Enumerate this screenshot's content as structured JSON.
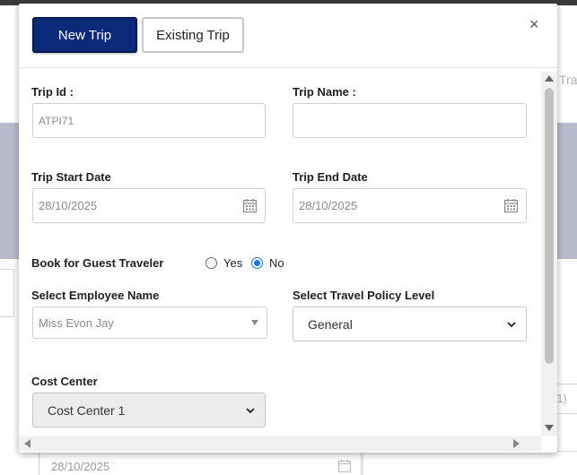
{
  "background": {
    "right_cut_text": "Tra",
    "right_field_cut_text": "(1)",
    "date_value": "28/10/2025"
  },
  "modal": {
    "tabs": {
      "new_trip": "New Trip",
      "existing_trip": "Existing Trip"
    },
    "close_symbol": "×",
    "fields": {
      "trip_id": {
        "label": "Trip Id :",
        "value": "ATPI71"
      },
      "trip_name": {
        "label": "Trip Name :",
        "value": ""
      },
      "trip_start_date": {
        "label": "Trip Start Date",
        "value": "28/10/2025"
      },
      "trip_end_date": {
        "label": "Trip End Date",
        "value": "28/10/2025"
      },
      "guest_traveler": {
        "label": "Book for Guest Traveler",
        "options": [
          "Yes",
          "No"
        ],
        "selected": "No"
      },
      "employee_name": {
        "label": "Select Employee Name",
        "value": "Miss Evon Jay"
      },
      "travel_policy": {
        "label": "Select Travel Policy Level",
        "value": "General"
      },
      "cost_center": {
        "label": "Cost Center",
        "value": "Cost Center 1"
      }
    }
  },
  "colors": {
    "primary_button": "#0b2a7a",
    "radio_accent": "#1a73e8",
    "background_band": "#b9bbcd"
  },
  "icons": {
    "calendar": "calendar-icon",
    "close": "close-icon",
    "dropdown": "chevron-down-icon"
  }
}
